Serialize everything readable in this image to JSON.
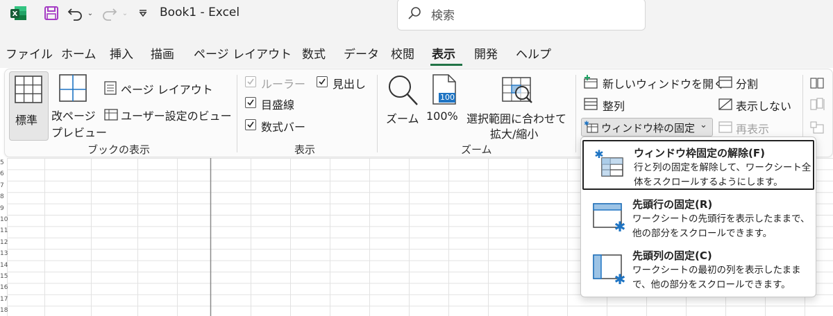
{
  "titlebar": {
    "app_icon": "excel-logo",
    "save_icon": "save-icon",
    "undo_icon": "undo-icon",
    "redo_icon": "redo-icon",
    "customize_icon": "customize-qat-icon",
    "doc_title": "Book1  -  Excel",
    "search_placeholder": "検索"
  },
  "tabs": [
    {
      "label": "ファイル"
    },
    {
      "label": "ホーム"
    },
    {
      "label": "挿入"
    },
    {
      "label": "描画"
    },
    {
      "label": "ページ レイアウト"
    },
    {
      "label": "数式"
    },
    {
      "label": "データ"
    },
    {
      "label": "校閲"
    },
    {
      "label": "表示",
      "active": true
    },
    {
      "label": "開発"
    },
    {
      "label": "ヘルプ"
    }
  ],
  "ribbon": {
    "workbook_views": {
      "group_label": "ブックの表示",
      "normal": "標準",
      "page_break_line1": "改ページ",
      "page_break_line2": "プレビュー",
      "page_layout": "ページ レイアウト",
      "custom_views": "ユーザー設定のビュー"
    },
    "show": {
      "group_label": "表示",
      "ruler": "ルーラー",
      "gridlines": "目盛線",
      "formula_bar": "数式バー",
      "headings": "見出し"
    },
    "zoom": {
      "group_label": "ズーム",
      "zoom": "ズーム",
      "zoom100": "100%",
      "zoom100_icon_text": "100",
      "zoom_selection_line1": "選択範囲に合わせて",
      "zoom_selection_line2": "拡大/縮小"
    },
    "window": {
      "new_window": "新しいウィンドウを開く",
      "arrange_all": "整列",
      "freeze_panes": "ウィンドウ枠の固定",
      "split": "分割",
      "hide": "表示しない",
      "unhide": "再表示"
    }
  },
  "sheet": {
    "row_numbers": [
      "5",
      "6",
      "7",
      "8",
      "9",
      "10",
      "11",
      "12",
      "13",
      "14",
      "15",
      "16",
      "17",
      "18"
    ]
  },
  "freeze_menu": {
    "items": [
      {
        "title": "ウィンドウ枠固定の解除(F)",
        "desc": "行と列の固定を解除して、ワークシート全体をスクロールするようにします。"
      },
      {
        "title": "先頭行の固定(R)",
        "desc": "ワークシートの先頭行を表示したままで、他の部分をスクロールできます。"
      },
      {
        "title": "先頭列の固定(C)",
        "desc": "ワークシートの最初の列を表示したままで、他の部分をスクロールできます。"
      }
    ]
  },
  "colors": {
    "excel_green": "#217346",
    "accent_blue": "#1e74c3"
  }
}
